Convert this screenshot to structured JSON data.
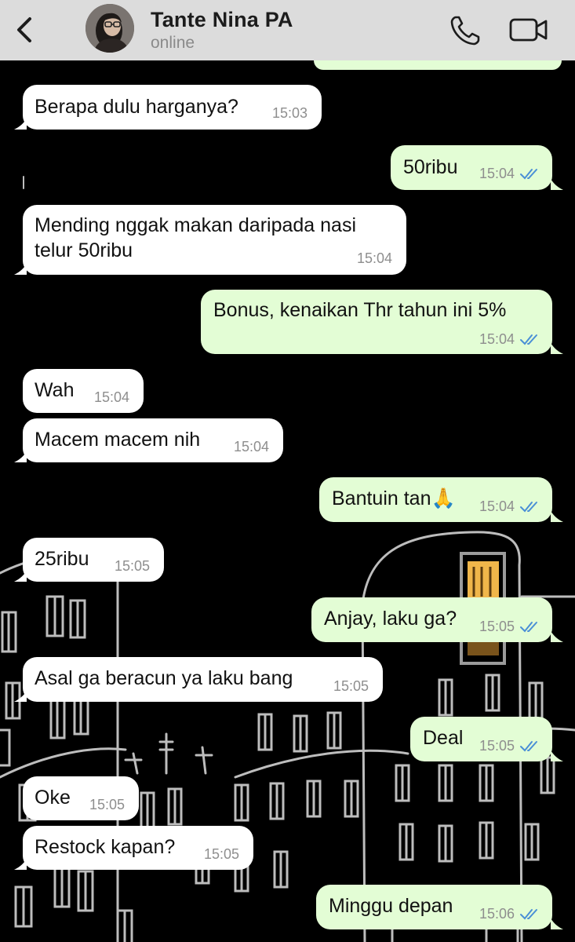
{
  "header": {
    "contact_name": "Tante Nina PA",
    "status": "online",
    "back_icon": "chevron-left-icon",
    "call_icon": "phone-icon",
    "video_icon": "video-camera-icon"
  },
  "colors": {
    "header_bg": "#dcdcdc",
    "incoming_bubble": "#ffffff",
    "outgoing_bubble": "#e3fdd5",
    "read_ticks": "#4a8fd6",
    "wallpaper": "#000000"
  },
  "messages": [
    {
      "dir": "in",
      "text": "Berapa dulu harganya?",
      "time": "15:03"
    },
    {
      "dir": "out",
      "text": "50ribu",
      "time": "15:04",
      "read": true
    },
    {
      "dir": "in",
      "text": "Mending nggak makan daripada nasi\ntelur 50ribu",
      "time": "15:04"
    },
    {
      "dir": "out",
      "text": "Bonus, kenaikan Thr tahun ini 5%",
      "time": "15:04",
      "read": true
    },
    {
      "dir": "in",
      "text": "Wah",
      "time": "15:04"
    },
    {
      "dir": "in",
      "text": "Macem macem nih",
      "time": "15:04"
    },
    {
      "dir": "out",
      "text": "Bantuin tan🙏",
      "time": "15:04",
      "read": true
    },
    {
      "dir": "in",
      "text": "25ribu",
      "time": "15:05"
    },
    {
      "dir": "out",
      "text": "Anjay, laku ga?",
      "time": "15:05",
      "read": true
    },
    {
      "dir": "in",
      "text": "Asal ga beracun ya laku bang",
      "time": "15:05"
    },
    {
      "dir": "out",
      "text": "Deal",
      "time": "15:05",
      "read": true
    },
    {
      "dir": "in",
      "text": "Oke",
      "time": "15:05"
    },
    {
      "dir": "in",
      "text": "Restock kapan?",
      "time": "15:05"
    },
    {
      "dir": "out",
      "text": "Minggu depan",
      "time": "15:06",
      "read": true
    }
  ]
}
